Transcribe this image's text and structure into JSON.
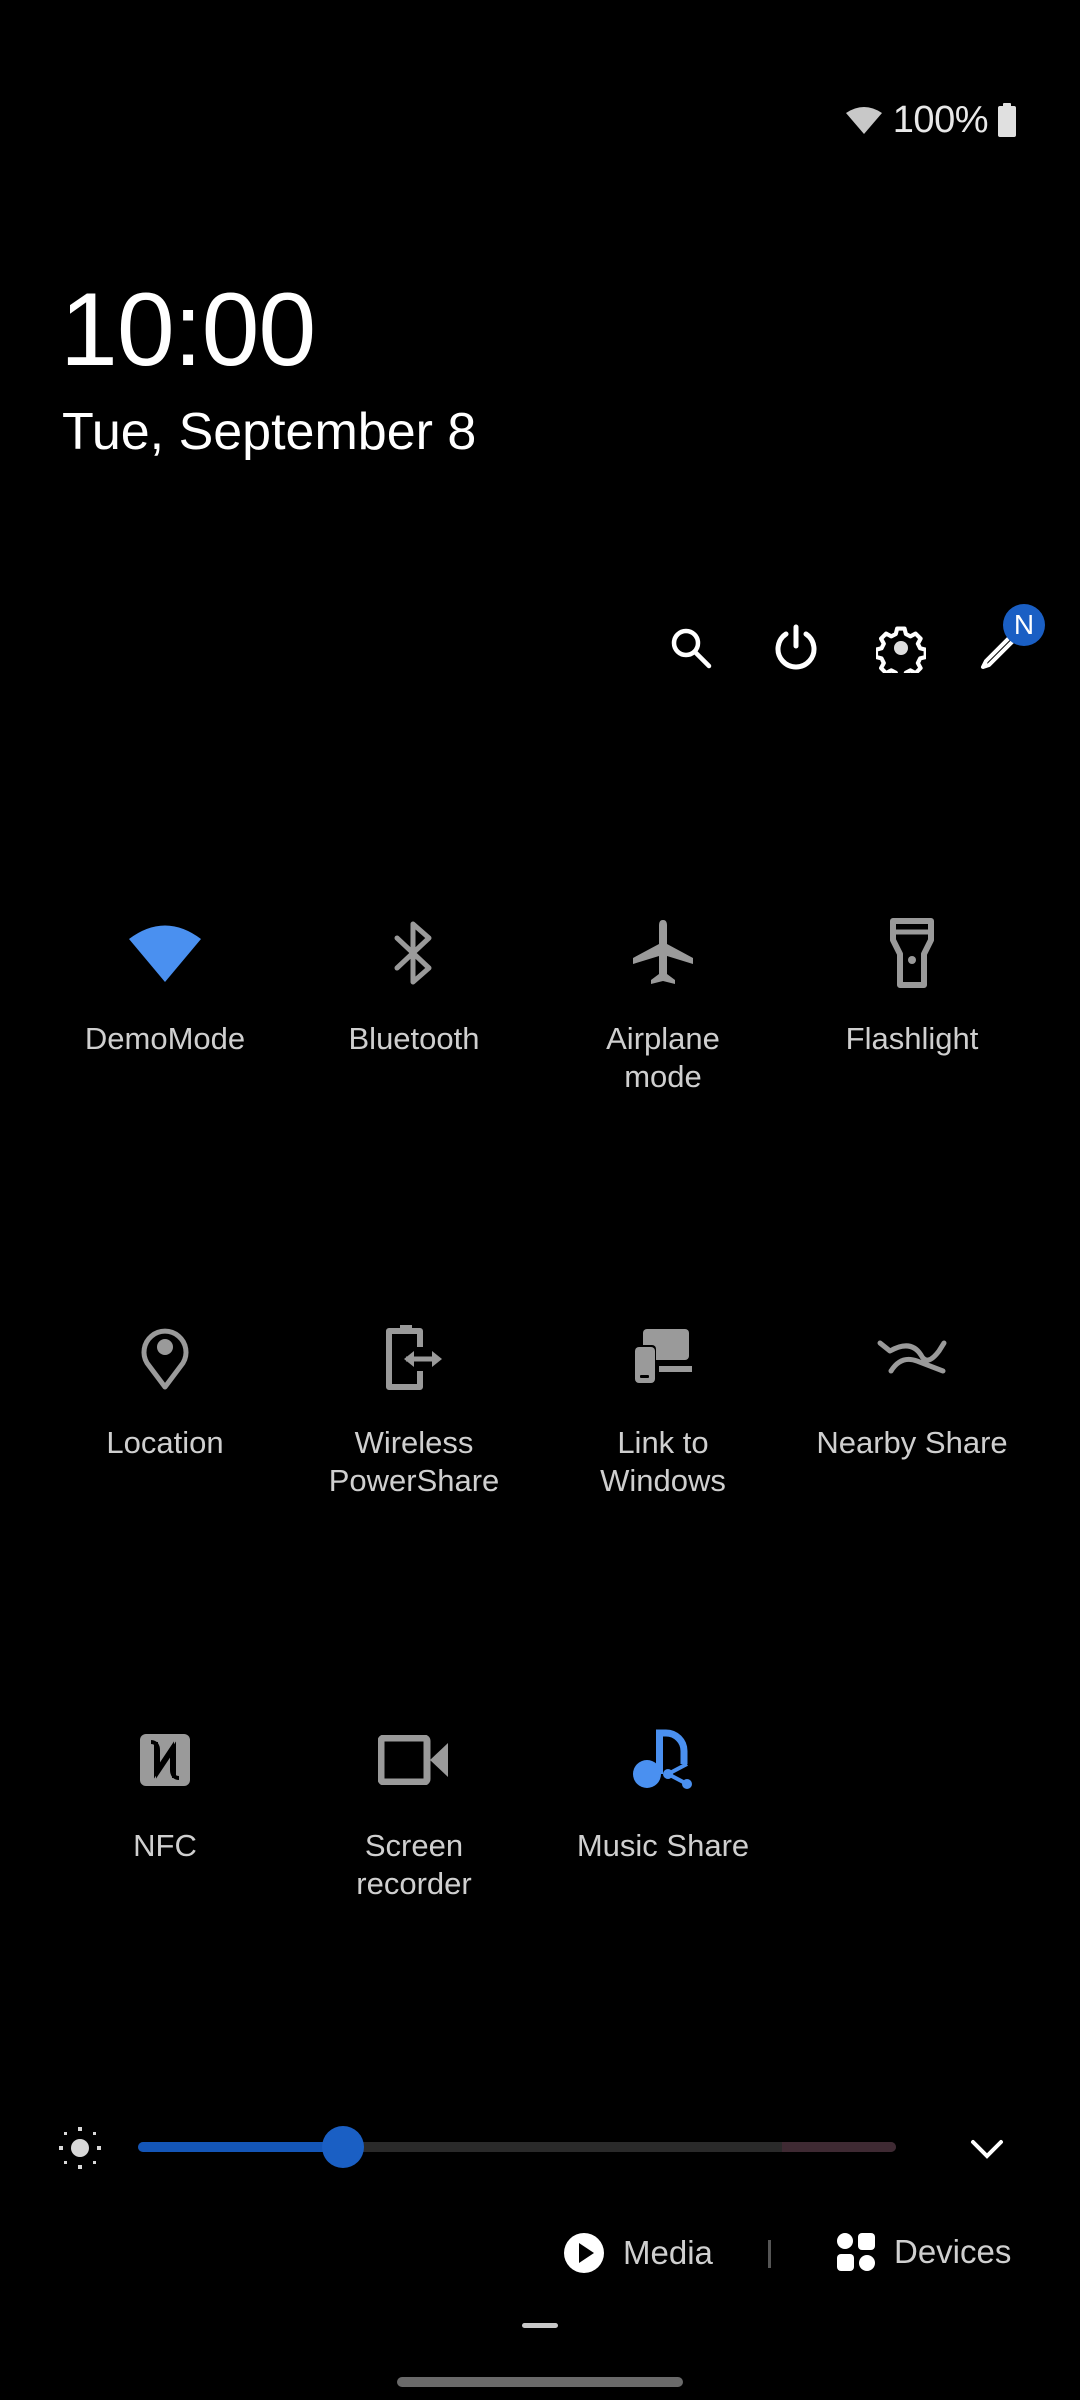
{
  "status_bar": {
    "wifi_icon": "wifi-icon",
    "battery_percent": "100%",
    "battery_icon": "battery-full-icon"
  },
  "clock": {
    "time": "10:00",
    "date": "Tue, September 8"
  },
  "actions": {
    "search": "search-icon",
    "power": "power-icon",
    "settings": "gear-icon",
    "edit": "pencil-icon",
    "edit_badge": "N"
  },
  "tiles": [
    {
      "label": "DemoMode",
      "icon": "wifi-icon",
      "active": true
    },
    {
      "label": "Bluetooth",
      "icon": "bluetooth-icon",
      "active": false
    },
    {
      "label": "Airplane\nmode",
      "icon": "airplane-icon",
      "active": false
    },
    {
      "label": "Flashlight",
      "icon": "flashlight-icon",
      "active": false
    },
    {
      "label": "Location",
      "icon": "location-pin-icon",
      "active": false
    },
    {
      "label": "Wireless\nPowerShare",
      "icon": "wireless-powershare-icon",
      "active": false
    },
    {
      "label": "Link to\nWindows",
      "icon": "link-to-windows-icon",
      "active": false
    },
    {
      "label": "Nearby Share",
      "icon": "nearby-share-icon",
      "active": false
    },
    {
      "label": "NFC",
      "icon": "nfc-icon",
      "active": false
    },
    {
      "label": "Screen\nrecorder",
      "icon": "video-camera-icon",
      "active": false
    },
    {
      "label": "Music Share",
      "icon": "music-share-icon",
      "active": true
    }
  ],
  "brightness": {
    "value_percent": 27,
    "extra_brightness_start_percent": 85,
    "icon": "brightness-icon",
    "expand_icon": "chevron-down-icon"
  },
  "bottom": {
    "media_label": "Media",
    "devices_label": "Devices"
  },
  "colors": {
    "accent": "#4a90f0",
    "slider_fill": "#1456b8",
    "thumb": "#1a5fc4",
    "inactive_icon": "#9a9a9a",
    "label": "#cfcfcf"
  }
}
